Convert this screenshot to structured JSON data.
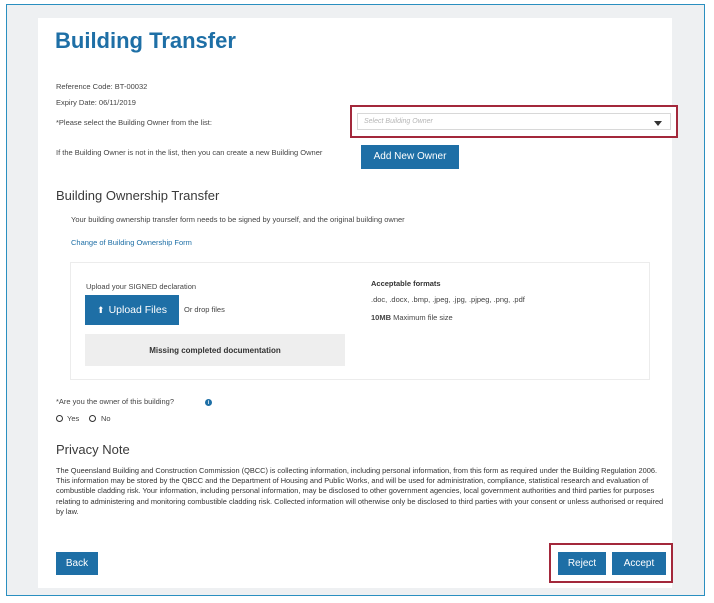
{
  "page": {
    "title": "Building Transfer",
    "reference_code": "Reference Code: BT-00032",
    "expiry_date": "Expiry Date: 06/11/2019",
    "select_owner_label": "*Please select the Building Owner from the list:",
    "owner_select": {
      "placeholder": "Select Building Owner"
    },
    "new_owner_hint": "If the Building Owner is not in the list, then you can create a new Building Owner",
    "add_owner_button": "Add New Owner"
  },
  "transfer": {
    "heading": "Building Ownership Transfer",
    "description": "Your building ownership transfer form needs to be signed by yourself, and the original building owner",
    "form_link": "Change of Building Ownership Form",
    "upload": {
      "label": "Upload your SIGNED declaration",
      "button": "Upload Files",
      "drop_text": "Or drop files",
      "status": "Missing completed documentation",
      "formats_heading": "Acceptable formats",
      "formats_list": ".doc, .docx, .bmp, .jpeg, .jpg, .pjpeg, .png, .pdf",
      "max_size_value": "10MB",
      "max_size_label": "Maximum file size"
    }
  },
  "ownership_question": {
    "label": "*Are you the owner of this building?",
    "options": [
      "Yes",
      "No"
    ]
  },
  "privacy": {
    "heading": "Privacy Note",
    "text": "The Queensland Building and Construction Commission (QBCC) is collecting information, including personal information, from this form as required under the Building Regulation 2006. This information may be stored by the QBCC and the Department of Housing and Public Works, and will be used for administration, compliance, statistical research and evaluation of combustible cladding risk. Your information, including personal information, may be disclosed to other government agencies, local government authorities and third parties for purposes relating to administering and monitoring combustible cladding risk. Collected information will otherwise only be disclosed to third parties with your consent or unless authorised or required by law."
  },
  "actions": {
    "back": "Back",
    "reject": "Reject",
    "accept": "Accept"
  },
  "colors": {
    "brand_blue": "#1e6fa6",
    "highlight_red": "#a3283b",
    "frame_blue": "#2a8fc0"
  },
  "icons": {
    "upload": "upload-icon",
    "select_caret": "chevron-down-icon",
    "info": "info-icon"
  }
}
